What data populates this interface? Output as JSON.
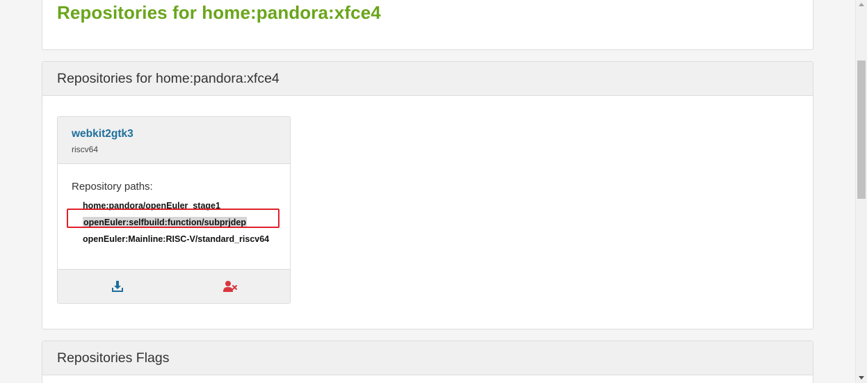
{
  "page": {
    "title": "Repositories for home:pandora:xfce4"
  },
  "repositories_card": {
    "header": "Repositories for home:pandora:xfce4",
    "repository": {
      "name": "webkit2gtk3",
      "arch": "riscv64",
      "paths_label": "Repository paths:",
      "paths": [
        "home:pandora/openEuler_stage1",
        "openEuler:selfbuild:function/subprjdep",
        "openEuler:Mainline:RISC-V/standard_riscv64"
      ],
      "actions": {
        "download_icon": "download-icon",
        "remove_user_icon": "user-remove-icon"
      }
    }
  },
  "flags_card": {
    "header": "Repositories Flags"
  },
  "colors": {
    "title_green": "#6aa51b",
    "link_blue": "#1e6f9c",
    "delete_red": "#d9363e",
    "annotation_red": "#e0202a"
  }
}
